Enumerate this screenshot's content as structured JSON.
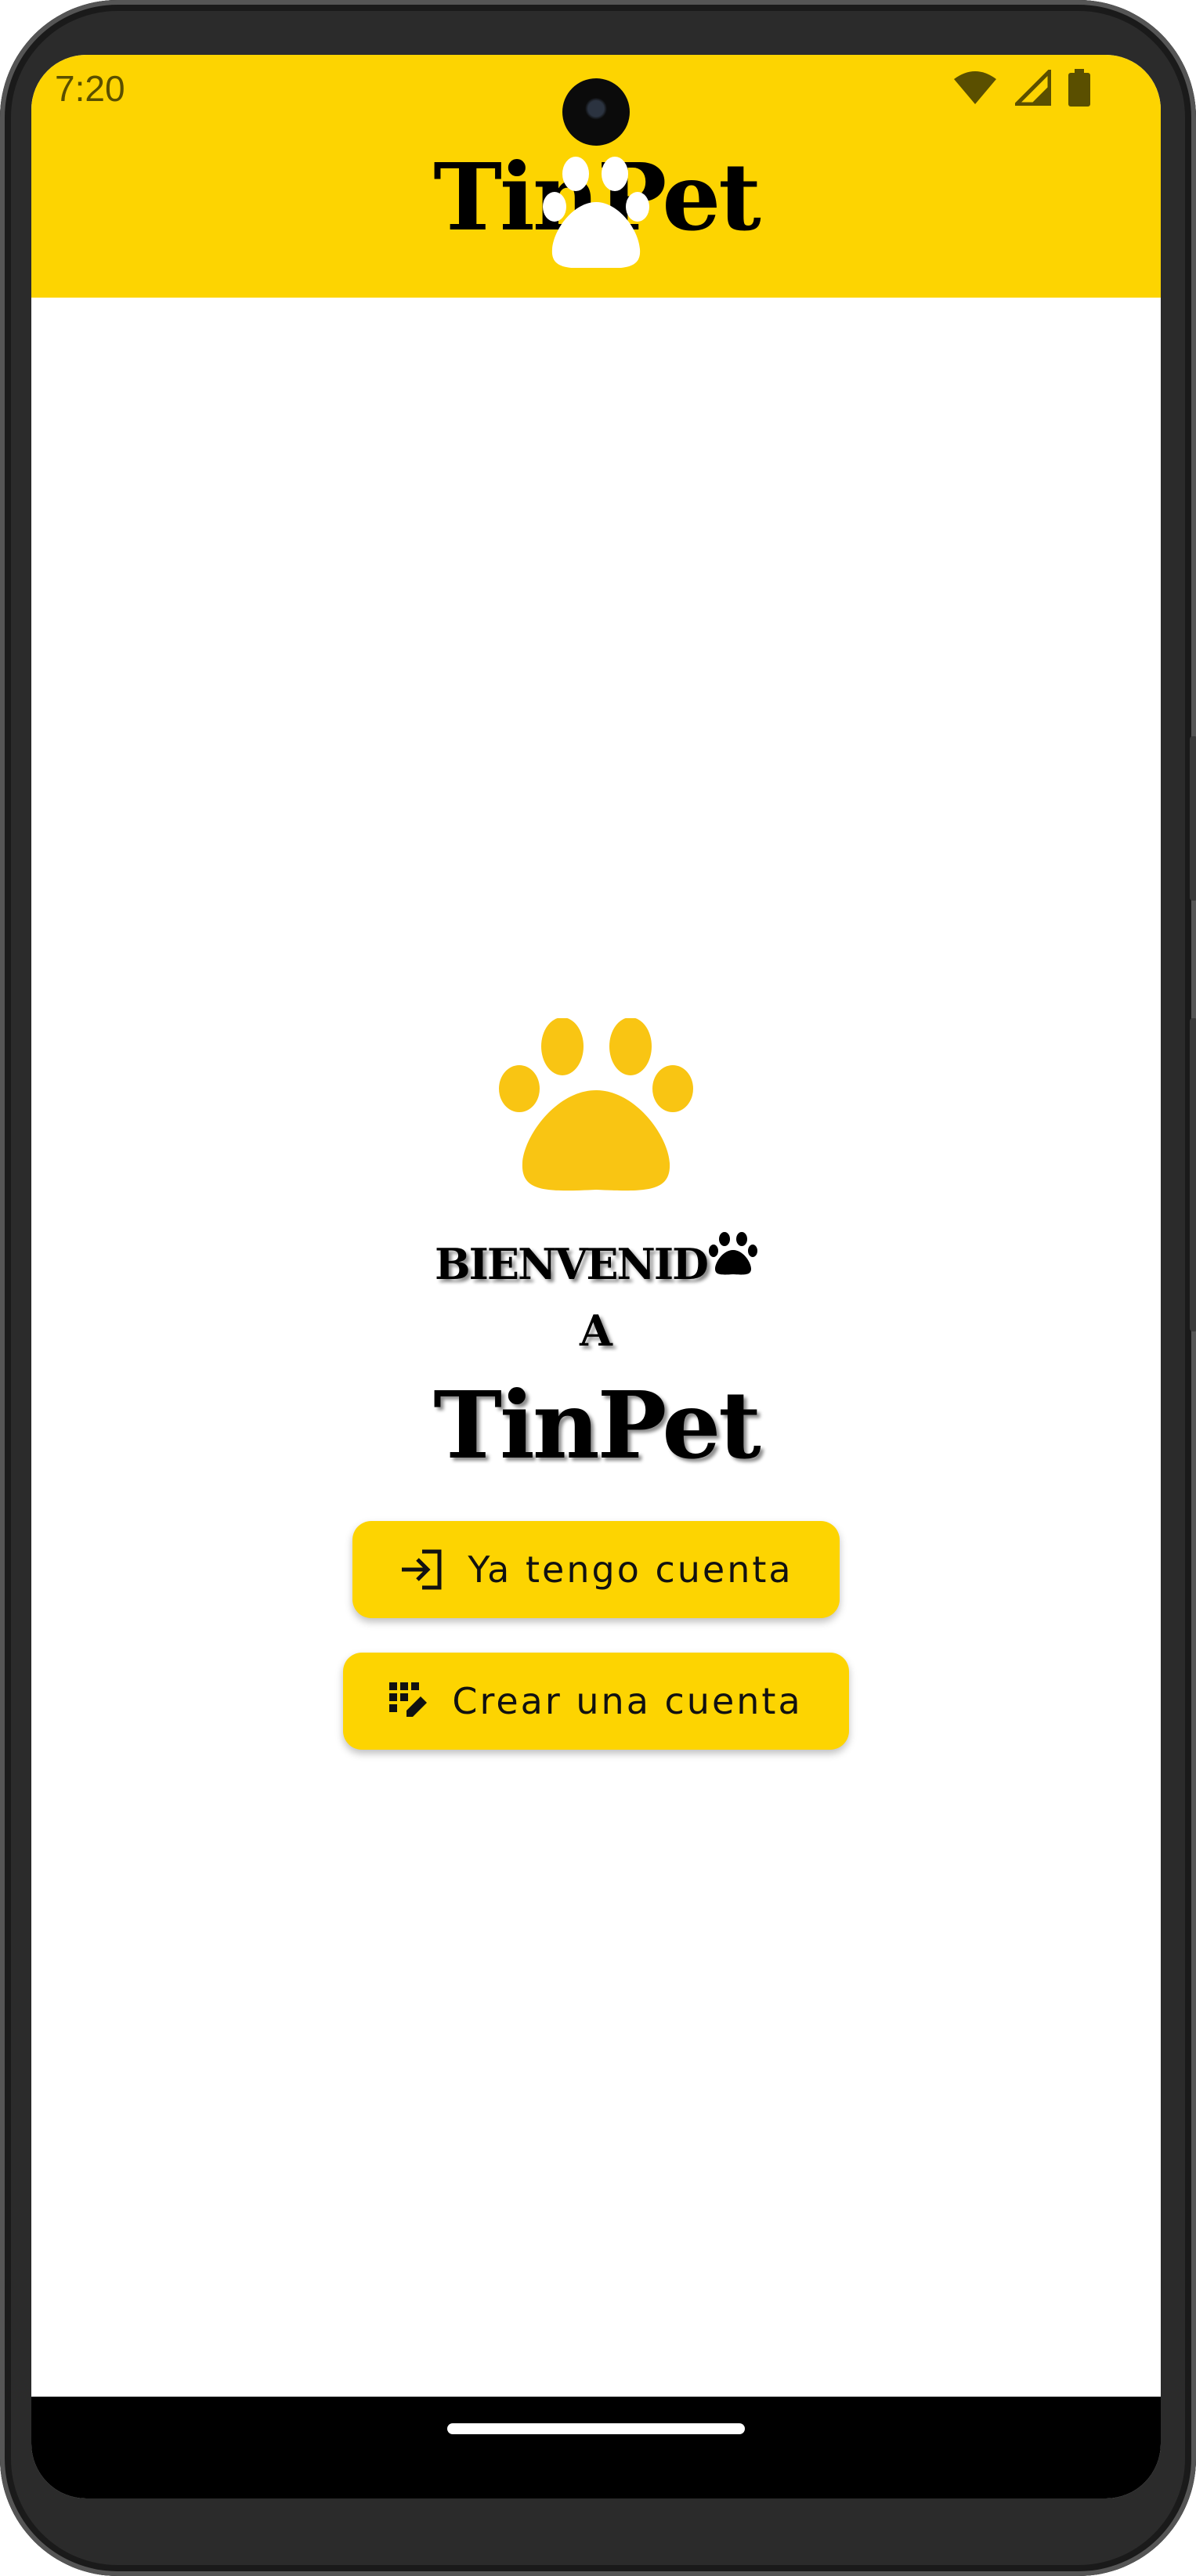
{
  "status_bar": {
    "time": "7:20",
    "icons": [
      "wifi-icon",
      "cellular-signal-icon",
      "battery-icon"
    ]
  },
  "app_bar": {
    "title": "TinPet",
    "background_color": "#FDD401"
  },
  "welcome": {
    "line1": "BIENVENID",
    "line2": "A",
    "line3": "TinPet",
    "logo_color": "#F9C513"
  },
  "buttons": {
    "login": {
      "label": "Ya tengo cuenta",
      "icon": "login-icon"
    },
    "create": {
      "label": "Crear una cuenta",
      "icon": "app-registration-icon"
    }
  }
}
